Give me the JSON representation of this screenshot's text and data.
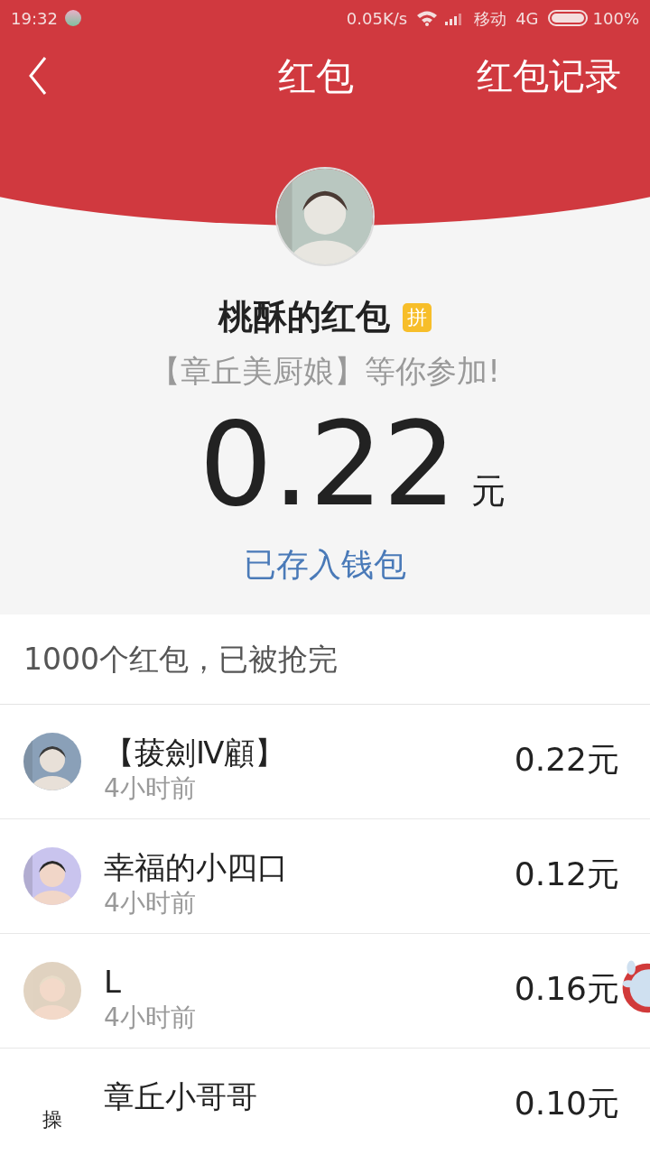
{
  "status_bar": {
    "time": "19:32",
    "speed": "0.05K/s",
    "carrier": "移动",
    "network": "4G",
    "battery": "100%"
  },
  "nav": {
    "title": "红包",
    "action": "红包记录"
  },
  "envelope": {
    "sender": "桃酥的红包",
    "badge": "拼",
    "greeting": "【章丘美厨娘】等你参加!",
    "amount": "0.22",
    "unit": "元",
    "note": "已存入钱包"
  },
  "summary": "1000个红包，已被抢完",
  "entries": [
    {
      "name": "【菝劍Ⅳ顧】",
      "time": "4小时前",
      "amount": "0.22元"
    },
    {
      "name": "幸福的小四口",
      "time": "4小时前",
      "amount": "0.12元"
    },
    {
      "name": "L",
      "time": "4小时前",
      "amount": "0.16元"
    },
    {
      "name": "章丘小哥哥",
      "amount": "0.10元",
      "avatar": {
        "kind": "text",
        "text": "操"
      }
    }
  ]
}
